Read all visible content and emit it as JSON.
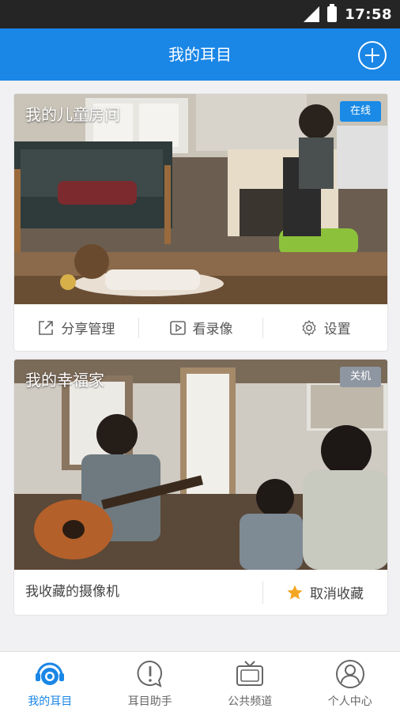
{
  "status_bar": {
    "time": "17:58"
  },
  "app_bar": {
    "title": "我的耳目"
  },
  "cameras": [
    {
      "title": "我的儿童房间",
      "status": "在线",
      "status_color": "#1a8ae6",
      "actions": [
        "分享管理",
        "看录像",
        "设置"
      ]
    },
    {
      "title": "我的幸福家",
      "status": "关机",
      "status_color": "#8e96a2",
      "left_label": "我收藏的摄像机",
      "right_label": "取消收藏"
    }
  ],
  "tabs": [
    {
      "label": "我的耳目",
      "icon": "camera-eye-icon",
      "active": true
    },
    {
      "label": "耳目助手",
      "icon": "alert-bubble-icon",
      "active": false
    },
    {
      "label": "公共频道",
      "icon": "tv-icon",
      "active": false
    },
    {
      "label": "个人中心",
      "icon": "person-icon",
      "active": false
    }
  ],
  "colors": {
    "accent": "#1a86e6",
    "star": "#f5a623"
  }
}
